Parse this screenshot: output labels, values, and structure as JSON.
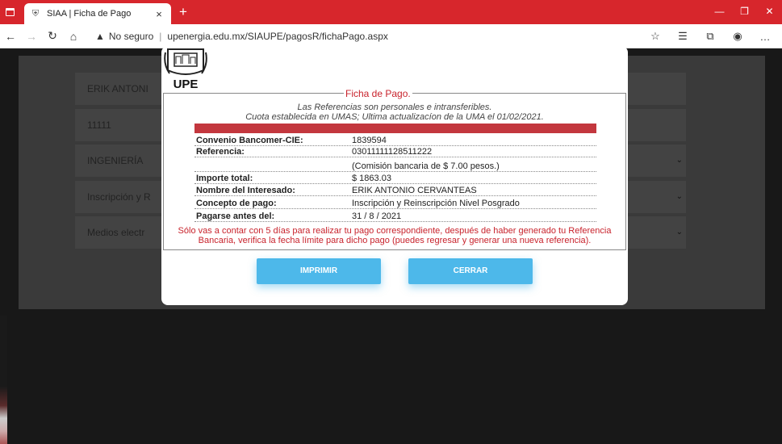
{
  "browser": {
    "tab_title": "SIAA | Ficha de Pago",
    "tab_close": "×",
    "new_tab": "+",
    "security_label": "No seguro",
    "url": "upenergia.edu.mx/SIAUPE/pagosR/fichaPago.aspx",
    "window_controls": [
      "—",
      "❐",
      "✕"
    ],
    "accent_color": "#d7262c"
  },
  "background_form": {
    "name_value": "ERIK ANTONI",
    "id_value": "11111",
    "program_value": "INGENIERÍA",
    "concept_value": "Inscripción y R",
    "payment_method_value": "Medios electr"
  },
  "modal": {
    "logo_text": "UPE",
    "legend": "Ficha de Pago.",
    "lead_line_1": "Las Referencias son personales e intransferibles.",
    "lead_line_2": "Cuota establecida en UMAS; Ultima actualizacíon de la UMA el 01/02/2021.",
    "fields": [
      {
        "label": "Convenio Bancomer-CIE:",
        "value": "1839594"
      },
      {
        "label": "Referencia:",
        "value": "03011111128511222"
      },
      {
        "label": "",
        "value": "(Comisión bancaria de $ 7.00 pesos.)"
      },
      {
        "label": "Importe total:",
        "value": "$ 1863.03"
      },
      {
        "label": "Nombre del Interesado:",
        "value": "ERIK ANTONIO CERVANTEAS"
      },
      {
        "label": "Concepto de pago:",
        "value": "Inscripción y Reinscripción Nivel Posgrado"
      },
      {
        "label": "Pagarse antes del:",
        "value": "31 / 8 / 2021"
      }
    ],
    "note_line_1": "Sólo vas a contar con 5 días para realizar tu pago correspondiente, después de haber generado tu Referencia",
    "note_line_2": "Bancaria, verifica la fecha límite para dicho pago (puedes regresar y generar una nueva referencia).",
    "print_button": "IMPRIMIR",
    "close_button": "CERRAR",
    "button_color": "#4db8ea",
    "bar_color": "#c3373e"
  }
}
